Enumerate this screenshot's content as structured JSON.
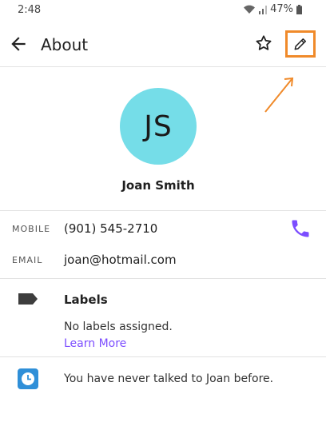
{
  "status_bar": {
    "time": "2:48",
    "battery": "47%"
  },
  "header": {
    "title": "About"
  },
  "contact": {
    "initials": "JS",
    "avatar_color": "#75dde8",
    "name": "Joan Smith",
    "mobile_label": "MOBILE",
    "mobile_value": "(901) 545-2710",
    "email_label": "EMAIL",
    "email_value": "joan@hotmail.com"
  },
  "labels": {
    "heading": "Labels",
    "empty_text": "No labels assigned.",
    "learn_more": "Learn More"
  },
  "history": {
    "text": "You have never talked to Joan before."
  },
  "colors": {
    "accent": "#7c4dff",
    "highlight": "#f08a2a"
  },
  "icons": [
    "back-arrow-icon",
    "star-icon",
    "pencil-icon",
    "phone-icon",
    "label-icon",
    "clock-icon",
    "wifi-icon",
    "signal-icon",
    "battery-icon"
  ]
}
